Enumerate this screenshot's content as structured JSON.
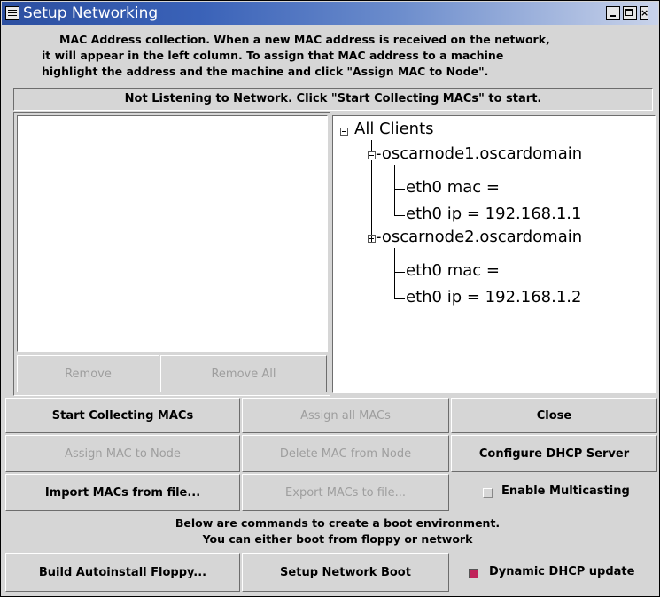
{
  "window": {
    "title": "Setup Networking",
    "title_bar_color": "#3a62b8"
  },
  "intro": {
    "line1": "MAC Address collection.  When a new MAC address is received on the network,",
    "line2": "it will appear in the left column.  To assign that MAC address to a machine",
    "line3": "highlight the address and the machine and click \"Assign MAC to Node\"."
  },
  "status": "Not Listening to Network. Click \"Start Collecting MACs\" to start.",
  "left_panel": {
    "remove_label": "Remove",
    "remove_all_label": "Remove All"
  },
  "tree": {
    "root": "All Clients",
    "nodes": [
      {
        "name": "-oscarnode1.oscardomain",
        "mac": "eth0 mac =",
        "ip": "eth0 ip = 192.168.1.1"
      },
      {
        "name": "-oscarnode2.oscardomain",
        "mac": "eth0 mac =",
        "ip": "eth0 ip = 192.168.1.2"
      }
    ]
  },
  "buttons": {
    "start_collecting": "Start Collecting MACs",
    "assign_all": "Assign all MACs",
    "close": "Close",
    "assign_mac": "Assign MAC to Node",
    "delete_mac": "Delete MAC from Node",
    "configure_dhcp": "Configure DHCP Server",
    "import_macs": "Import MACs from file...",
    "export_macs": "Export MACs to file...",
    "build_floppy": "Build Autoinstall Floppy...",
    "setup_boot": "Setup Network Boot"
  },
  "options": {
    "multicast_label": "Enable Multicasting",
    "multicast_checked": false,
    "dhcp_update_label": "Dynamic DHCP update",
    "dhcp_update_checked": true,
    "checked_color": "#c0225a"
  },
  "boot": {
    "line1": "Below are commands to create a boot environment.",
    "line2": "You can either boot from floppy or network"
  }
}
